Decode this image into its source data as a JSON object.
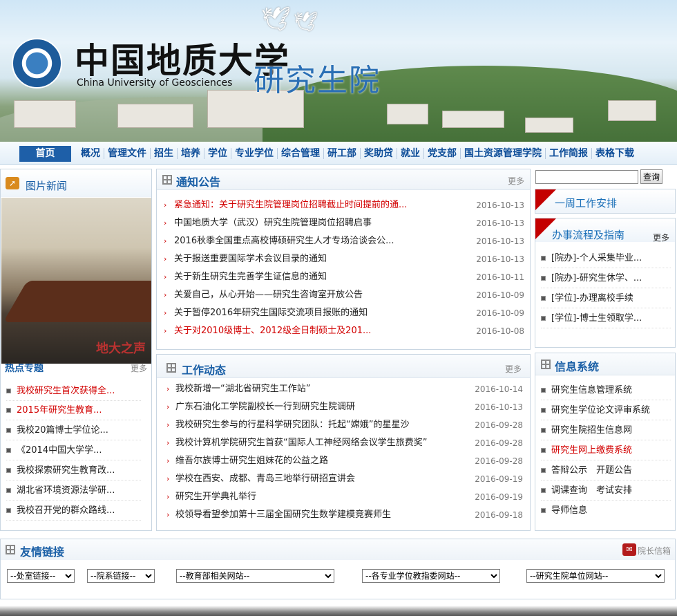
{
  "header": {
    "title_cn": "中国地质大学",
    "title_en": "China University of Geosciences",
    "dept": "研究生院"
  },
  "nav": {
    "home": "首页",
    "items": [
      "概况",
      "管理文件",
      "招生",
      "培养",
      "学位",
      "专业学位",
      "综合管理",
      "研工部",
      "奖助贷",
      "就业",
      "党支部",
      "国土资源管理学院",
      "工作简报",
      "表格下载"
    ]
  },
  "pic_news": {
    "title": "图片新闻",
    "caption": "地大之声"
  },
  "hot": {
    "title": "热点专题",
    "more": "更多",
    "items": [
      {
        "text": "我校研究生首次获得全...",
        "red": true
      },
      {
        "text": "2015年研究生教育...",
        "red": true
      },
      {
        "text": "我校20篇博士学位论...",
        "red": false
      },
      {
        "text": "《2014中国大学学...",
        "red": false
      },
      {
        "text": "我校探索研究生教育改...",
        "red": false
      },
      {
        "text": "湖北省环境资源法学研...",
        "red": false
      },
      {
        "text": "我校召开党的群众路线...",
        "red": false
      }
    ]
  },
  "notice": {
    "title": "通知公告",
    "more": "更多",
    "items": [
      {
        "text": "紧急通知：关于研究生院管理岗位招聘截止时间提前的通...",
        "date": "2016-10-13",
        "red": true
      },
      {
        "text": "中国地质大学（武汉）研究生院管理岗位招聘启事",
        "date": "2016-10-13",
        "red": false
      },
      {
        "text": "2016秋季全国重点高校博硕研究生人才专场洽谈会公...",
        "date": "2016-10-13",
        "red": false
      },
      {
        "text": "关于报送重要国际学术会议目录的通知",
        "date": "2016-10-13",
        "red": false
      },
      {
        "text": "关于新生研究生完善学生证信息的通知",
        "date": "2016-10-11",
        "red": false
      },
      {
        "text": "关爱自己，从心开始——研究生咨询室开放公告",
        "date": "2016-10-09",
        "red": false
      },
      {
        "text": "关于暂停2016年研究生国际交流项目报账的通知",
        "date": "2016-10-09",
        "red": false
      },
      {
        "text": "关于对2010级博士、2012级全日制硕士及201...",
        "date": "2016-10-08",
        "red": true
      }
    ]
  },
  "work": {
    "title": "工作动态",
    "more": "更多",
    "items": [
      {
        "text": "我校新增一“湖北省研究生工作站”",
        "date": "2016-10-14"
      },
      {
        "text": "广东石油化工学院副校长一行到研究生院调研",
        "date": "2016-10-13"
      },
      {
        "text": "我校研究生参与的行星科学研究团队：托起“嫦娥”的星星沙",
        "date": "2016-09-28"
      },
      {
        "text": "我校计算机学院研究生首获“国际人工神经网络会议学生旅费奖”",
        "date": "2016-09-28"
      },
      {
        "text": "维吾尔族博士研究生姐妹花的公益之路",
        "date": "2016-09-28"
      },
      {
        "text": "学校在西安、成都、青岛三地举行研招宣讲会",
        "date": "2016-09-19"
      },
      {
        "text": "研究生开学典礼举行",
        "date": "2016-09-19"
      },
      {
        "text": "校领导看望参加第十三届全国研究生数学建模竞赛师生",
        "date": "2016-09-18"
      }
    ]
  },
  "search": {
    "button": "查询",
    "value": ""
  },
  "weekly": {
    "title": "一周工作安排"
  },
  "process": {
    "title": "办事流程及指南",
    "more": "更多",
    "items": [
      "[院办]-个人采集毕业...",
      "[院办]-研究生休学、...",
      "[学位]-办理离校手续",
      "[学位]-博士生领取学..."
    ]
  },
  "info": {
    "title": "信息系统",
    "items": [
      {
        "text": "研究生信息管理系统",
        "red": false
      },
      {
        "text": "研究生学位论文评审系统",
        "red": false
      },
      {
        "text": "研究生院招生信息网",
        "red": false
      },
      {
        "text": "研究生网上缴费系统",
        "red": true
      },
      {
        "text": "答辩公示　开题公告",
        "red": false
      },
      {
        "text": "调课查询　考试安排",
        "red": false
      },
      {
        "text": "导师信息",
        "red": false
      }
    ]
  },
  "links": {
    "title": "友情链接",
    "mailbox": "院长信箱",
    "selects": [
      "--处室链接--",
      "--院系链接--",
      "--教育部相关网站--",
      "--各专业学位教指委网站--",
      "--研究生院单位网站--"
    ]
  }
}
